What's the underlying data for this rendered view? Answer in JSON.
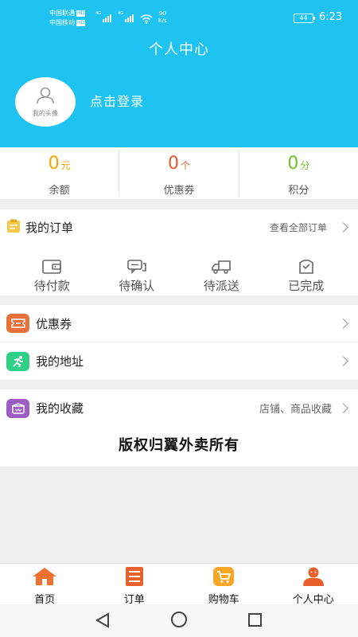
{
  "status_bar": {
    "carrier1": "中国联通",
    "carrier2": "中国移动",
    "hd": "HD",
    "net_type": "4G",
    "speed_value": "90",
    "speed_unit": "K/s",
    "battery": "44",
    "time": "6:23"
  },
  "header": {
    "title": "个人中心",
    "avatar_label": "我的头像",
    "login_text": "点击登录",
    "bg_color": "#1ec3f2"
  },
  "stats": [
    {
      "value": "0",
      "unit": "元",
      "label": "余额",
      "color": "#f0a500"
    },
    {
      "value": "0",
      "unit": "个",
      "label": "优惠券",
      "color": "#e9582e"
    },
    {
      "value": "0",
      "unit": "分",
      "label": "积分",
      "color": "#6cc324"
    }
  ],
  "orders": {
    "title": "我的订单",
    "view_all": "查看全部订单",
    "items": [
      {
        "label": "待付款",
        "icon": "wallet-icon"
      },
      {
        "label": "待确认",
        "icon": "chat-icon"
      },
      {
        "label": "待派送",
        "icon": "truck-icon"
      },
      {
        "label": "已完成",
        "icon": "bag-check-icon"
      }
    ]
  },
  "menu": {
    "coupons": {
      "label": "优惠券",
      "icon": "ticket-icon",
      "color": "#e8703a"
    },
    "address": {
      "label": "我的地址",
      "icon": "runner-icon",
      "color": "#2fcf86"
    },
    "favorites": {
      "label": "我的收藏",
      "extra": "店铺、商品收藏",
      "icon": "favorites-box-icon",
      "color": "#9c5cc4"
    }
  },
  "copyright": "版权归翼外卖所有",
  "tabbar": [
    {
      "label": "首页",
      "icon": "home-icon"
    },
    {
      "label": "订单",
      "icon": "order-list-icon"
    },
    {
      "label": "购物车",
      "icon": "cart-icon"
    },
    {
      "label": "个人中心",
      "icon": "profile-icon"
    }
  ],
  "accent_color": "#f0702e"
}
